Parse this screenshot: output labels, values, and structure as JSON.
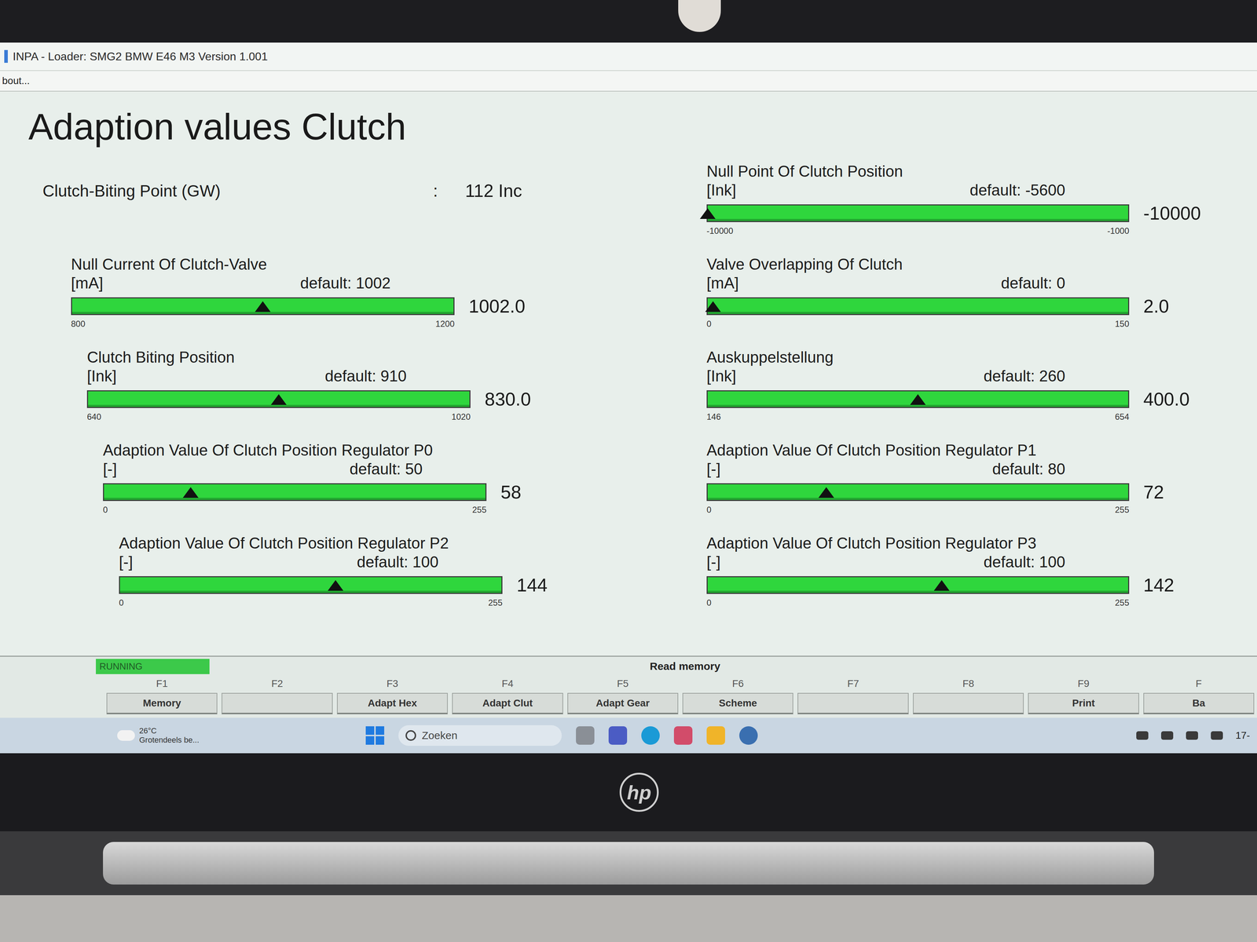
{
  "window": {
    "title": "INPA - Loader: SMG2 BMW E46 M3 Version 1.001"
  },
  "menu": [
    "bout..."
  ],
  "heading": "Adaption values Clutch",
  "biting_point": {
    "label": "Clutch-Biting Point (GW)",
    "separator": ":",
    "value": "112 Inc"
  },
  "left_gauges": [
    {
      "name": "Null Current Of Clutch-Valve",
      "unit": "[mA]",
      "default": "default: 1002",
      "min": "800",
      "max": "1200",
      "value": "1002.0",
      "level": 0.5
    },
    {
      "name": "Clutch Biting Position",
      "unit": "[Ink]",
      "default": "default: 910",
      "min": "640",
      "max": "1020",
      "value": "830.0",
      "level": 0.5
    },
    {
      "name": "Adaption Value Of Clutch Position Regulator P0",
      "unit": "[-]",
      "default": "default: 50",
      "min": "0",
      "max": "255",
      "value": "58",
      "level": 0.227
    },
    {
      "name": "Adaption Value Of Clutch Position Regulator P2",
      "unit": "[-]",
      "default": "default: 100",
      "min": "0",
      "max": "255",
      "value": "144",
      "level": 0.565
    }
  ],
  "right_gauges": [
    {
      "name": "Null Point Of Clutch Position",
      "unit": "[Ink]",
      "default": "default: -5600",
      "min": "-10000",
      "max": "-1000",
      "value": "-10000",
      "level": 0.0
    },
    {
      "name": "Valve Overlapping Of Clutch",
      "unit": "[mA]",
      "default": "default: 0",
      "min": "0",
      "max": "150",
      "value": "2.0",
      "level": 0.013
    },
    {
      "name": "Auskuppelstellung",
      "unit": "[Ink]",
      "default": "default: 260",
      "min": "146",
      "max": "654",
      "value": "400.0",
      "level": 0.5
    },
    {
      "name": "Adaption Value Of Clutch Position Regulator P1",
      "unit": "[-]",
      "default": "default: 80",
      "min": "0",
      "max": "255",
      "value": "72",
      "level": 0.282
    },
    {
      "name": "Adaption Value Of Clutch Position Regulator P3",
      "unit": "[-]",
      "default": "default: 100",
      "min": "0",
      "max": "255",
      "value": "142",
      "level": 0.557
    }
  ],
  "status": {
    "state": "RUNNING",
    "message": "Read memory"
  },
  "function_keys": [
    {
      "key": "F1",
      "label": "Memory"
    },
    {
      "key": "F2",
      "label": ""
    },
    {
      "key": "F3",
      "label": "Adapt Hex"
    },
    {
      "key": "F4",
      "label": "Adapt Clut"
    },
    {
      "key": "F5",
      "label": "Adapt Gear"
    },
    {
      "key": "F6",
      "label": "Scheme"
    },
    {
      "key": "F7",
      "label": ""
    },
    {
      "key": "F8",
      "label": ""
    },
    {
      "key": "F9",
      "label": "Print"
    },
    {
      "key": "F",
      "label": "Ba"
    }
  ],
  "taskbar": {
    "weather": {
      "temp": "26°C",
      "text": "Grotendeels be..."
    },
    "search": "Zoeken",
    "clock": "17-"
  },
  "laptop": {
    "logo": "hp"
  }
}
